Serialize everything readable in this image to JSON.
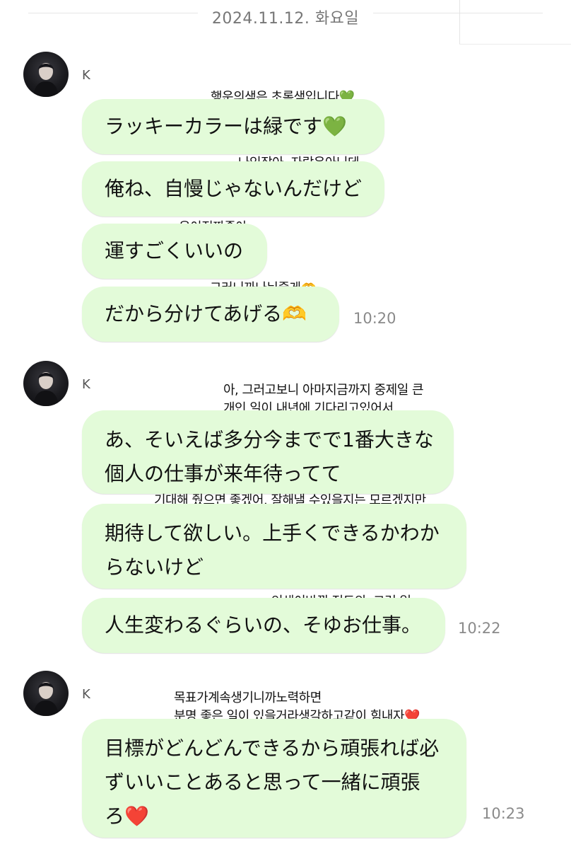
{
  "date_divider": "2024.11.12. 화요일",
  "groups": [
    {
      "sender": "K",
      "time": "10:20",
      "messages": [
        {
          "text": "ラッキーカラーは緑です💚",
          "note": "행운의색은 초록색입니다💚"
        },
        {
          "text": "俺ね、自慢じゃないんだけど",
          "note": "나있잖아, 자랑은아닌데"
        },
        {
          "text": "運すごくいいの",
          "note": "운이진짜좋아"
        },
        {
          "text": "だから分けてあげる🫶",
          "note": "그러니까나눠줄게🫶"
        }
      ]
    },
    {
      "sender": "K",
      "time": "10:22",
      "messages": [
        {
          "text": "あ、そいえば多分今までで1番大きな\n個人の仕事が来年待ってて",
          "note": "아, 그러고보니 아마지금까지 중제일 큰\n개인 일이 내년에 기다리고있어서"
        },
        {
          "text": "期待して欲しい。上手くできるかわか\nらないけど",
          "note": "기대해 줬으면 좋겠어. 잘해낼 수있을지는 모르겠지만"
        },
        {
          "text": "人生変わるぐらいの、そゆお仕事。",
          "note": "인생이바뀔 정도의, 그런 일."
        }
      ]
    },
    {
      "sender": "K",
      "time": "10:23",
      "messages": [
        {
          "text": "目標がどんどんできるから頑張れば必\nずいいことあると思って一緒に頑張\nろ❤️",
          "note": "목표가계속생기니까노력하면\n분명 좋은 일이 있을거라생각하고같이 힘내자❤️"
        }
      ]
    }
  ]
}
